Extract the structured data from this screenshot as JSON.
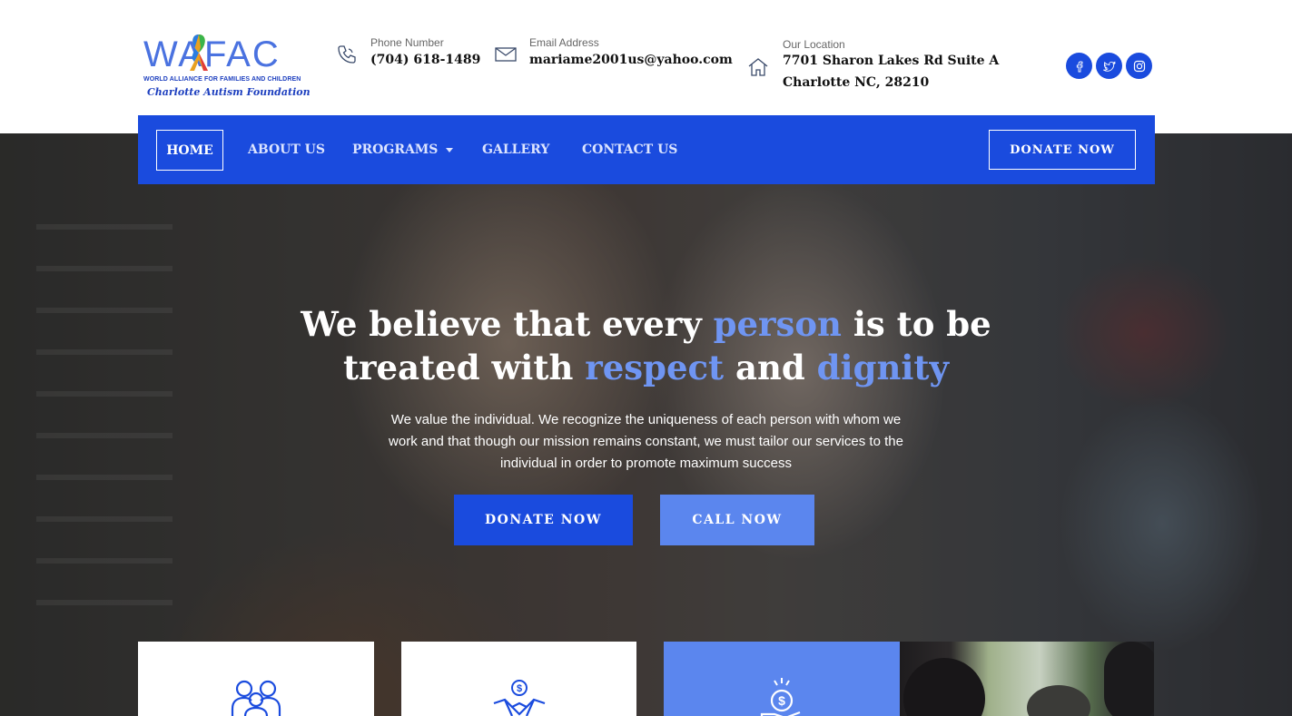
{
  "colors": {
    "brand_blue": "#1a4bde",
    "light_blue": "#5b86ee",
    "highlight_text": "#6f95f2"
  },
  "logo": {
    "main_text": "WAFAC",
    "subtitle_line1": "WORLD ALLIANCE FOR FAMILIES AND CHILDREN",
    "subtitle_line2": "Charlotte Autism Foundation",
    "icon": "autism-puzzle-ribbon"
  },
  "header": {
    "phone": {
      "icon": "phone-icon",
      "label": "Phone Number",
      "value": "(704) 618-1489"
    },
    "email": {
      "icon": "mail-icon",
      "label": "Email Address",
      "value": "mariame2001us@yahoo.com"
    },
    "location": {
      "icon": "home-icon",
      "label": "Our Location",
      "line1": "7701 Sharon Lakes Rd Suite A",
      "line2": "Charlotte NC, 28210"
    },
    "social": [
      {
        "icon": "facebook-icon"
      },
      {
        "icon": "twitter-icon"
      },
      {
        "icon": "instagram-icon"
      }
    ]
  },
  "nav": {
    "items": [
      {
        "label": "HOME",
        "active": true
      },
      {
        "label": "ABOUT US"
      },
      {
        "label": "PROGRAMS",
        "has_dropdown": true
      },
      {
        "label": "GALLERY"
      },
      {
        "label": "CONTACT US"
      }
    ],
    "donate_label": "DONATE NOW"
  },
  "hero": {
    "title": {
      "part1": "We believe that every ",
      "highlight1": "person",
      "part2": " is to be",
      "part3": "treated with ",
      "highlight2": "respect",
      "part4": " and ",
      "highlight3": "dignity"
    },
    "text": "We value the individual. We recognize the uniqueness of each person with whom we work and that though our mission remains constant, we must tailor our services to the individual in order to promote maximum success",
    "donate_label": "DONATE NOW",
    "call_label": "CALL NOW"
  },
  "cards": [
    {
      "icon": "family-icon"
    },
    {
      "icon": "donation-handshake-icon"
    },
    {
      "icon": "money-hand-icon"
    },
    {
      "icon": "photo"
    }
  ]
}
